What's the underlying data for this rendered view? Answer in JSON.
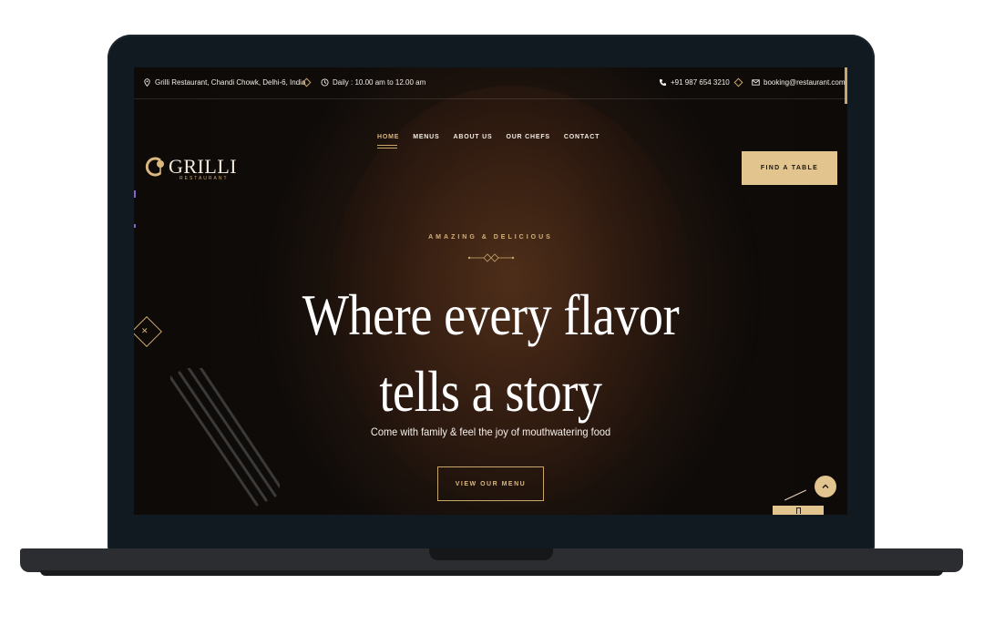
{
  "topbar": {
    "address": "Grilli Restaurant, Chandi Chowk, Delhi-6, India",
    "hours": "Daily : 10.00 am to 12.00 am",
    "phone": "+91 987 654 3210",
    "email": "booking@restaurant.com"
  },
  "logo": {
    "name": "GRILLI",
    "tagline": "RESTAURANT"
  },
  "nav": {
    "items": [
      {
        "label": "HOME",
        "active": true
      },
      {
        "label": "MENUS",
        "active": false
      },
      {
        "label": "ABOUT US",
        "active": false
      },
      {
        "label": "OUR CHEFS",
        "active": false
      },
      {
        "label": "CONTACT",
        "active": false
      }
    ]
  },
  "cta": {
    "find_table": "FIND A TABLE"
  },
  "hero": {
    "eyebrow": "AMAZING & DELICIOUS",
    "headline_line1": "Where every flavor",
    "headline_line2": "tells a story",
    "subtitle": "Come with family & feel the joy of mouthwatering food",
    "menu_button": "VIEW OUR MENU"
  },
  "colors": {
    "accent": "#e2c48f",
    "accent_dark": "#c9a66b",
    "frame": "#121a21"
  },
  "icons": {
    "location": "map-pin-icon",
    "clock": "clock-icon",
    "phone": "phone-icon",
    "mail": "mail-icon",
    "back_to_top": "chevron-up-icon"
  }
}
